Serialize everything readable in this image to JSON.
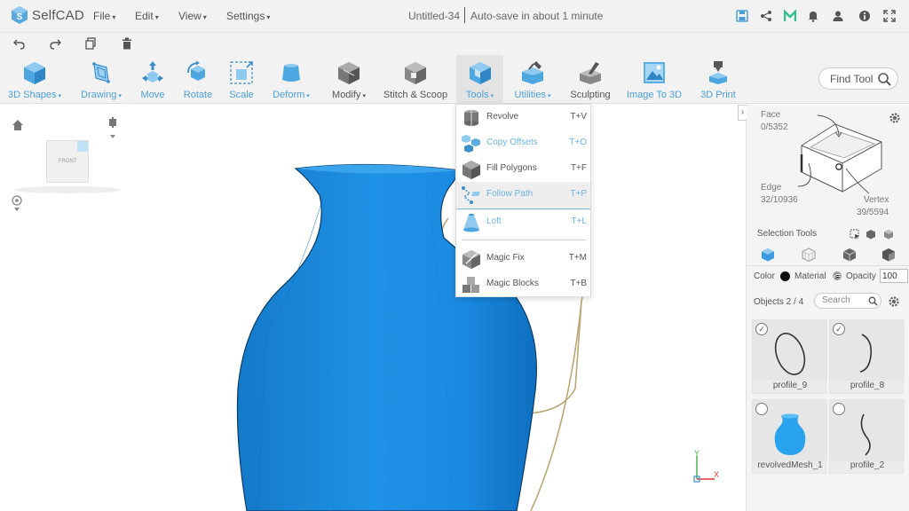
{
  "app": {
    "name": "SelfCAD"
  },
  "menubar": {
    "items": [
      {
        "label": "File"
      },
      {
        "label": "Edit"
      },
      {
        "label": "View"
      },
      {
        "label": "Settings"
      }
    ],
    "doc_title": "Untitled-34",
    "autosave": "Auto-save in about 1 minute"
  },
  "toolbar": {
    "tools": [
      {
        "label": "3D Shapes"
      },
      {
        "label": "Drawing"
      },
      {
        "label": "Move"
      },
      {
        "label": "Rotate"
      },
      {
        "label": "Scale"
      },
      {
        "label": "Deform"
      },
      {
        "label": "Modify"
      },
      {
        "label": "Stitch & Scoop"
      },
      {
        "label": "Tools"
      },
      {
        "label": "Utilities"
      },
      {
        "label": "Sculpting"
      },
      {
        "label": "Image To 3D"
      },
      {
        "label": "3D Print"
      }
    ],
    "find_tool": "Find Tool"
  },
  "tools_menu": {
    "items": [
      {
        "label": "Revolve",
        "shortcut": "T+V"
      },
      {
        "label": "Copy Offsets",
        "shortcut": "T+O"
      },
      {
        "label": "Fill Polygons",
        "shortcut": "T+F"
      },
      {
        "label": "Follow Path",
        "shortcut": "T+P"
      },
      {
        "label": "Loft",
        "shortcut": "T+L"
      },
      {
        "label": "Magic Fix",
        "shortcut": "T+M"
      },
      {
        "label": "Magic Blocks",
        "shortcut": "T+B"
      }
    ]
  },
  "viewport": {
    "nav_cube_label": "FRONT",
    "axis_y": "Y",
    "axis_x": "X",
    "model_color": "#1a8fe0"
  },
  "right_panel": {
    "face_label": "Face",
    "face_count": "0/5352",
    "edge_label": "Edge",
    "edge_count": "32/10936",
    "vertex_label": "Vertex",
    "vertex_count": "39/5594",
    "selection_tools": "Selection Tools",
    "color_label": "Color",
    "material_label": "Material",
    "opacity_label": "Opacity",
    "opacity_value": "100",
    "objects_label": "Objects 2 / 4",
    "search_placeholder": "Search",
    "objects": [
      {
        "name": "profile_9",
        "checked": true
      },
      {
        "name": "profile_8",
        "checked": true
      },
      {
        "name": "revolvedMesh_1",
        "checked": false
      },
      {
        "name": "profile_2",
        "checked": false
      }
    ]
  },
  "colors": {
    "accent": "#4b9fd6",
    "toolbar_bg": "#f2f2f2"
  }
}
